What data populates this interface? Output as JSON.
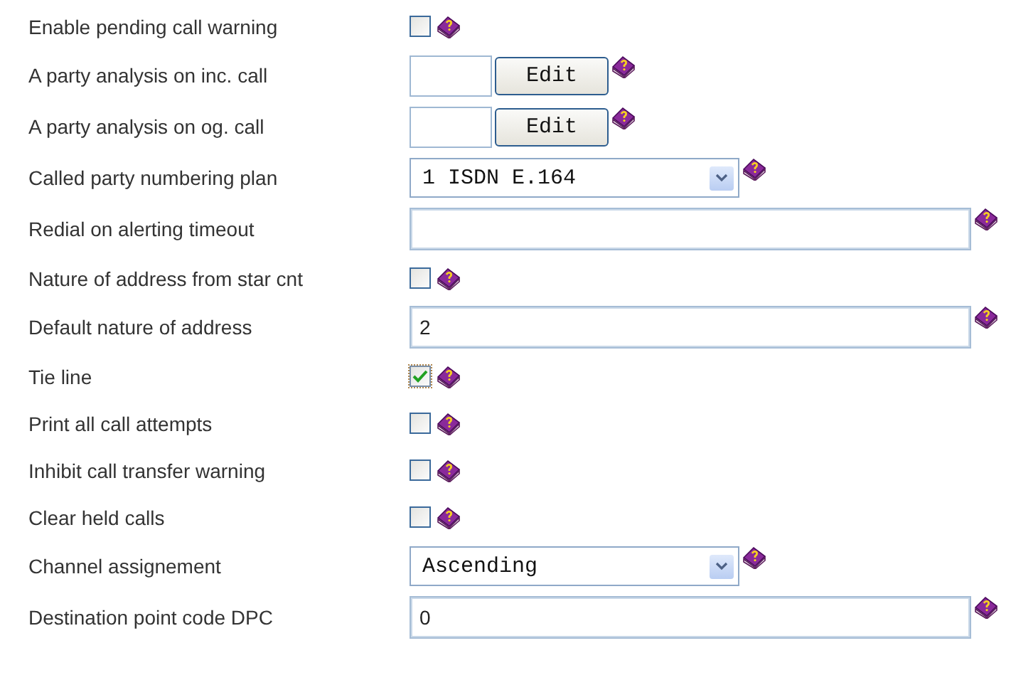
{
  "settings": [
    {
      "label": "Enable pending call warning",
      "kind": "checkbox",
      "checked": false
    },
    {
      "label": "A party analysis on inc. call",
      "kind": "edit",
      "button": "Edit"
    },
    {
      "label": "A party analysis on og. call",
      "kind": "edit",
      "button": "Edit"
    },
    {
      "label": "Called party numbering plan",
      "kind": "select",
      "value": "1 ISDN E.164"
    },
    {
      "label": "Redial on alerting timeout",
      "kind": "text"
    },
    {
      "label": "Nature of address from star cnt",
      "kind": "checkbox",
      "checked": false
    },
    {
      "label": "Default nature of address",
      "kind": "text",
      "value": "2"
    },
    {
      "label": "Tie line",
      "kind": "checkbox",
      "checked": true
    },
    {
      "label": "Print all call attempts",
      "kind": "checkbox",
      "checked": false
    },
    {
      "label": "Inhibit call transfer warning",
      "kind": "checkbox",
      "checked": false
    },
    {
      "label": "Clear held calls",
      "kind": "checkbox",
      "checked": false
    },
    {
      "label": "Channel assignement",
      "kind": "select",
      "value": "Ascending"
    },
    {
      "label": "Destination point code DPC",
      "kind": "text",
      "value": "0"
    }
  ]
}
